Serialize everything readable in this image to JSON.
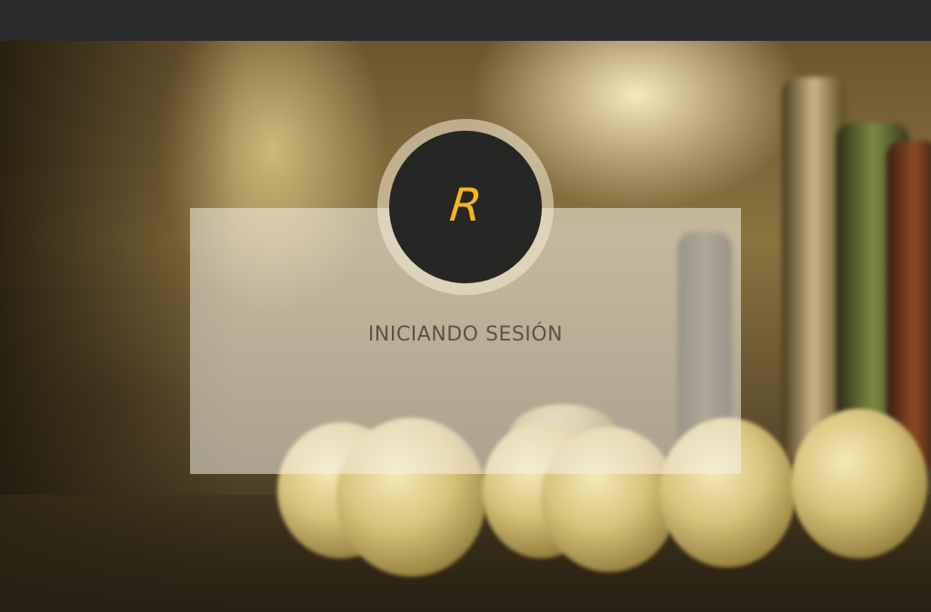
{
  "logo": {
    "letter": "R",
    "accent_color": "#f2b623",
    "circle_color": "#262624"
  },
  "status": {
    "text": "INICIANDO SESIÓN"
  }
}
